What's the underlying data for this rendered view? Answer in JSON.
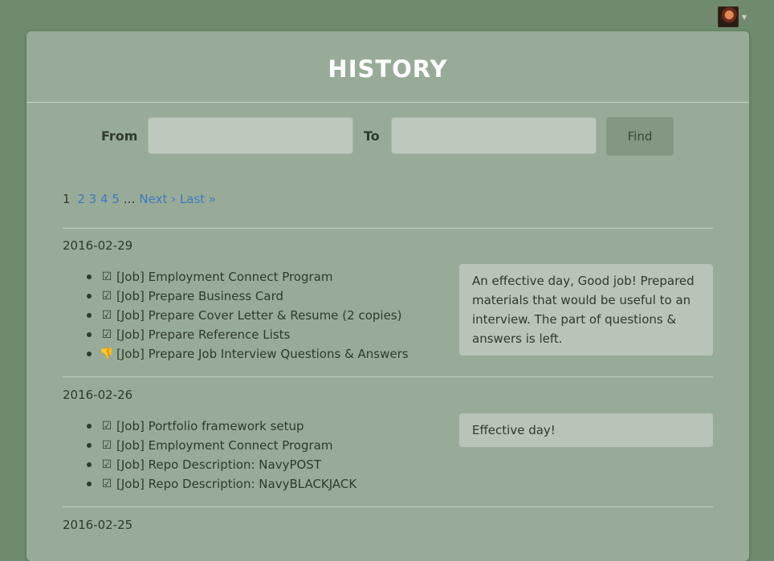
{
  "header": {
    "avatar_alt": "user avatar"
  },
  "page": {
    "title": "HISTORY"
  },
  "search": {
    "from_label": "From",
    "to_label": "To",
    "from_value": "",
    "to_value": "",
    "find_label": "Find"
  },
  "pagination": {
    "current": "1",
    "pages": [
      "2",
      "3",
      "4",
      "5"
    ],
    "ellipsis": "…",
    "next": "Next ›",
    "last": "Last »"
  },
  "days": [
    {
      "date": "2016-02-29",
      "tasks": [
        {
          "status": "done",
          "text": "[Job] Employment Connect Program"
        },
        {
          "status": "done",
          "text": "[Job] Prepare Business Card"
        },
        {
          "status": "done",
          "text": "[Job] Prepare Cover Letter & Resume (2 copies)"
        },
        {
          "status": "done",
          "text": "[Job] Prepare Reference Lists"
        },
        {
          "status": "not-done",
          "text": "[Job] Prepare Job Interview Questions & Answers"
        }
      ],
      "note": "An effective day, Good job! Prepared materials that would be useful to an interview. The part of questions & answers is left."
    },
    {
      "date": "2016-02-26",
      "tasks": [
        {
          "status": "done",
          "text": "[Job] Portfolio framework setup"
        },
        {
          "status": "done",
          "text": "[Job] Employment Connect Program"
        },
        {
          "status": "done",
          "text": "[Job] Repo Description: NavyPOST"
        },
        {
          "status": "done",
          "text": "[Job] Repo Description: NavyBLACKJACK"
        }
      ],
      "note": "Effective day!"
    },
    {
      "date": "2016-02-25",
      "tasks": [],
      "note": ""
    }
  ],
  "icons": {
    "done": "check-square-icon",
    "not-done": "thumbs-down-icon"
  }
}
